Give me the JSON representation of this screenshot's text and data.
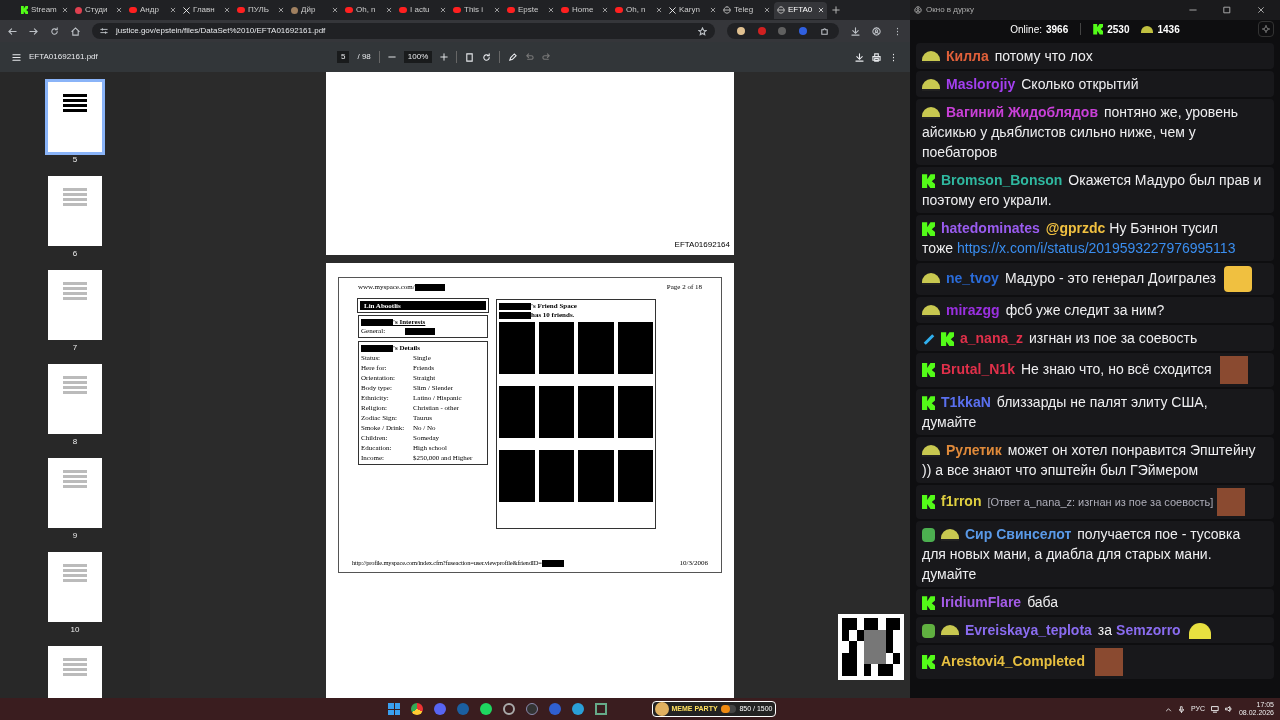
{
  "browser": {
    "tabs": [
      {
        "label": "Stream",
        "kind": "k",
        "selected": false
      },
      {
        "label": "Студи",
        "kind": "square",
        "selected": false
      },
      {
        "label": "Андр",
        "kind": "video",
        "selected": false
      },
      {
        "label": "Главн",
        "kind": "x",
        "selected": false
      },
      {
        "label": "ПУЛЬ",
        "kind": "video",
        "selected": false
      },
      {
        "label": "Дйр",
        "kind": "avatar",
        "selected": false
      },
      {
        "label": "Oh, n",
        "kind": "video",
        "selected": false
      },
      {
        "label": "I actu",
        "kind": "video",
        "selected": false
      },
      {
        "label": "This i",
        "kind": "video",
        "selected": false
      },
      {
        "label": "Epste",
        "kind": "video",
        "selected": false
      },
      {
        "label": "Home",
        "kind": "video",
        "selected": false
      },
      {
        "label": "Oh, n",
        "kind": "video",
        "selected": false
      },
      {
        "label": "Karyn",
        "kind": "x",
        "selected": false
      },
      {
        "label": "Teleg",
        "kind": "globe",
        "selected": false
      },
      {
        "label": "EFTA0",
        "kind": "globe",
        "selected": true
      }
    ],
    "url": "justice.gov/epstein/files/DataSet%2010/EFTA01692161.pdf"
  },
  "pdf": {
    "filename": "EFTA01692161.pdf",
    "page": "5",
    "page_count": "/ 98",
    "zoom": "100%",
    "thumbnails": [
      {
        "number": "5",
        "selected": true
      },
      {
        "number": "6",
        "selected": false
      },
      {
        "number": "7",
        "selected": false
      },
      {
        "number": "8",
        "selected": false
      },
      {
        "number": "9",
        "selected": false
      },
      {
        "number": "10",
        "selected": false
      },
      {
        "selected": false
      }
    ],
    "page_id": "EFTA01692164",
    "scan": {
      "header_url": "www.myspace.com/",
      "page_label": "Page 2 of 18",
      "profile_name": "Lin Abootlis",
      "interests_title": "'s Interests",
      "interests_label": "General:",
      "details_title": "'s Details",
      "details": [
        {
          "label": "Status:",
          "value": "Single"
        },
        {
          "label": "Here for:",
          "value": "Friends"
        },
        {
          "label": "Orientation:",
          "value": "Straight"
        },
        {
          "label": "Body type:",
          "value": "Slim / Slender"
        },
        {
          "label": "Ethnicity:",
          "value": "Latino / Hispanic"
        },
        {
          "label": "Religion:",
          "value": "Christian - other"
        },
        {
          "label": "Zodiac Sign:",
          "value": "Taurus"
        },
        {
          "label": "Smoke / Drink:",
          "value": "No / No"
        },
        {
          "label": "Children:",
          "value": "Someday"
        },
        {
          "label": "Education:",
          "value": "High school"
        },
        {
          "label": "Income:",
          "value": "$250,000 and Higher"
        }
      ],
      "friends_title": "'s Friend Space",
      "friends_count": "has 10 friends.",
      "footer_url": "http://profile.myspace.com/index.cfm?fuseaction=user.viewprofile&friendID=",
      "date": "10/3/2006"
    }
  },
  "chat": {
    "window_title": "Окно в дурку",
    "online_label": "Online:",
    "online": "3966",
    "k_count": "2530",
    "other_count": "1436",
    "messages": [
      {
        "badges": [
          {
            "kind": "hat"
          }
        ],
        "user": "Килла",
        "color": "#e0603a",
        "parts": [
          {
            "kind": "text",
            "text": "потому что лох"
          }
        ]
      },
      {
        "badges": [
          {
            "kind": "hat"
          }
        ],
        "user": "Maslorojiy",
        "color": "#a43ff0",
        "parts": [
          {
            "kind": "text",
            "text": "Сколько открытий"
          }
        ]
      },
      {
        "badges": [
          {
            "kind": "hat"
          }
        ],
        "user": "Вагиний Жидоблядов",
        "color": "#c940d8",
        "parts": [
          {
            "kind": "text",
            "text": "понтяно же, уровень айсикью у дьяблистов сильно ниже, чем у поебаторов"
          }
        ]
      },
      {
        "badges": [
          {
            "kind": "k"
          }
        ],
        "user": "Bromson_Bonson",
        "color": "#2fb8a0",
        "parts": [
          {
            "kind": "text",
            "text": "Окажется Мадуро был прав и поэтому его украли."
          }
        ]
      },
      {
        "badges": [
          {
            "kind": "k"
          }
        ],
        "user": "hatedominates",
        "color": "#9a5cf0",
        "parts": [
          {
            "kind": "mention",
            "text": "@gprzdc"
          },
          {
            "kind": "text",
            "text": "Ну Бэннон тусил тоже"
          },
          {
            "kind": "link",
            "text": "https://x.com/i/status/2019593227976995113"
          }
        ]
      },
      {
        "badges": [
          {
            "kind": "hat"
          }
        ],
        "user": "ne_tvoy",
        "color": "#2a6bd8",
        "parts": [
          {
            "kind": "text",
            "text": "Мадуро - это генерал Доигралез"
          },
          {
            "kind": "laugh_emote"
          }
        ]
      },
      {
        "badges": [
          {
            "kind": "hat"
          }
        ],
        "user": "mirazgg",
        "color": "#9a30e0",
        "parts": [
          {
            "kind": "text",
            "text": "фсб уже следит за ним?"
          }
        ]
      },
      {
        "badges": [
          {
            "kind": "sword"
          },
          {
            "kind": "k"
          }
        ],
        "user": "a_nana_z",
        "color": "#e0304a",
        "parts": [
          {
            "kind": "text",
            "text": "изгнан из пое за соевость"
          }
        ]
      },
      {
        "badges": [
          {
            "kind": "k"
          }
        ],
        "user": "Brutal_N1k",
        "color": "#e0304a",
        "parts": [
          {
            "kind": "text",
            "text": "Не знаю что, но всё сходится"
          },
          {
            "kind": "photo_emote"
          }
        ]
      },
      {
        "badges": [
          {
            "kind": "k"
          }
        ],
        "user": "T1kkaN",
        "color": "#5a70f0",
        "parts": [
          {
            "kind": "text",
            "text": "близзарды не палят элиту США, думайте"
          }
        ]
      },
      {
        "badges": [
          {
            "kind": "hat"
          }
        ],
        "user": "Рулетик",
        "color": "#e08a3a",
        "parts": [
          {
            "kind": "text",
            "text": "может он хотел понравится Эпштейну )) а все знают что эпштейн был ГЭймером"
          }
        ]
      },
      {
        "badges": [
          {
            "kind": "k"
          }
        ],
        "user": "f1rron",
        "color": "#e0d040",
        "parts": [
          {
            "kind": "reply",
            "text": "[Ответ a_nana_z: изгнан из пое за соевость]"
          },
          {
            "kind": "photo_emote"
          }
        ]
      },
      {
        "badges": [
          {
            "kind": "shield"
          },
          {
            "kind": "hat"
          }
        ],
        "user": "Сир Свинселот",
        "color": "#5a9ae8",
        "parts": [
          {
            "kind": "text",
            "text": "получается пое - тусовка для новых мани, а диабла для старых мани. думайте"
          }
        ]
      },
      {
        "badges": [
          {
            "kind": "k"
          }
        ],
        "user": "IridiumFlare",
        "color": "#a45ce8",
        "parts": [
          {
            "kind": "text",
            "text": "баба"
          }
        ]
      },
      {
        "badges": [
          {
            "kind": "pen"
          },
          {
            "kind": "hat"
          }
        ],
        "user": "Evreiskaya_teplota",
        "color": "#8a6cf0",
        "parts": [
          {
            "kind": "text",
            "text": "за"
          },
          {
            "kind": "mention_user",
            "text": "Semzorro"
          },
          {
            "kind": "hat_emote"
          }
        ]
      },
      {
        "badges": [
          {
            "kind": "k"
          }
        ],
        "user": "Arestovi4_Completed",
        "color": "#e8c040",
        "parts": [
          {
            "kind": "photo_emote"
          }
        ]
      }
    ]
  },
  "taskbar": {
    "widget": {
      "title": "MEME PARTY",
      "progress": "850 / 1500",
      "level": 0.57
    },
    "language": "РУС",
    "time": "17:05",
    "date": "08.02.2026"
  }
}
